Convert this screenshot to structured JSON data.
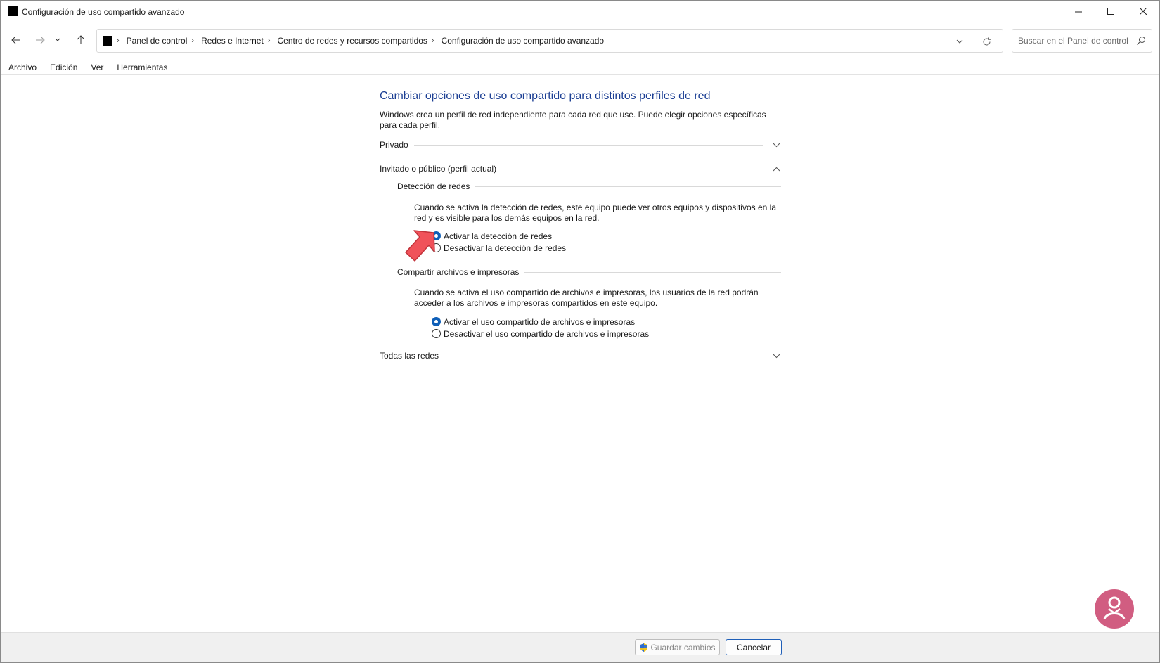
{
  "window": {
    "title": "Configuración de uso compartido avanzado"
  },
  "address": {
    "crumbs": [
      "Panel de control",
      "Redes e Internet",
      "Centro de redes y recursos compartidos",
      "Configuración de uso compartido avanzado"
    ]
  },
  "search": {
    "placeholder": "Buscar en el Panel de control"
  },
  "menu": {
    "items": [
      "Archivo",
      "Edición",
      "Ver",
      "Herramientas"
    ]
  },
  "content": {
    "heading": "Cambiar opciones de uso compartido para distintos perfiles de red",
    "description": "Windows crea un perfil de red independiente para cada red que use. Puede elegir opciones específicas para cada perfil.",
    "profiles": {
      "private": {
        "label": "Privado",
        "expanded": false
      },
      "guest": {
        "label": "Invitado o público (perfil actual)",
        "expanded": true
      },
      "all": {
        "label": "Todas las redes",
        "expanded": false
      }
    },
    "network_discovery": {
      "title": "Detección de redes",
      "description": "Cuando se activa la detección de redes, este equipo puede ver otros equipos y dispositivos en la red y es visible para los demás equipos en la red.",
      "on_label": "Activar la detección de redes",
      "off_label": "Desactivar la detección de redes",
      "selected": "on"
    },
    "file_sharing": {
      "title": "Compartir archivos e impresoras",
      "description": "Cuando se activa el uso compartido de archivos e impresoras, los usuarios de la red podrán acceder a los archivos e impresoras compartidos en este equipo.",
      "on_label": "Activar el uso compartido de archivos e impresoras",
      "off_label": "Desactivar el uso compartido de archivos e impresoras",
      "selected": "on"
    }
  },
  "footer": {
    "save_label": "Guardar cambios",
    "cancel_label": "Cancelar"
  },
  "colors": {
    "heading": "#1c3f94",
    "radio_selected": "#0f5fb8",
    "annotation_arrow": "#f0525a"
  }
}
